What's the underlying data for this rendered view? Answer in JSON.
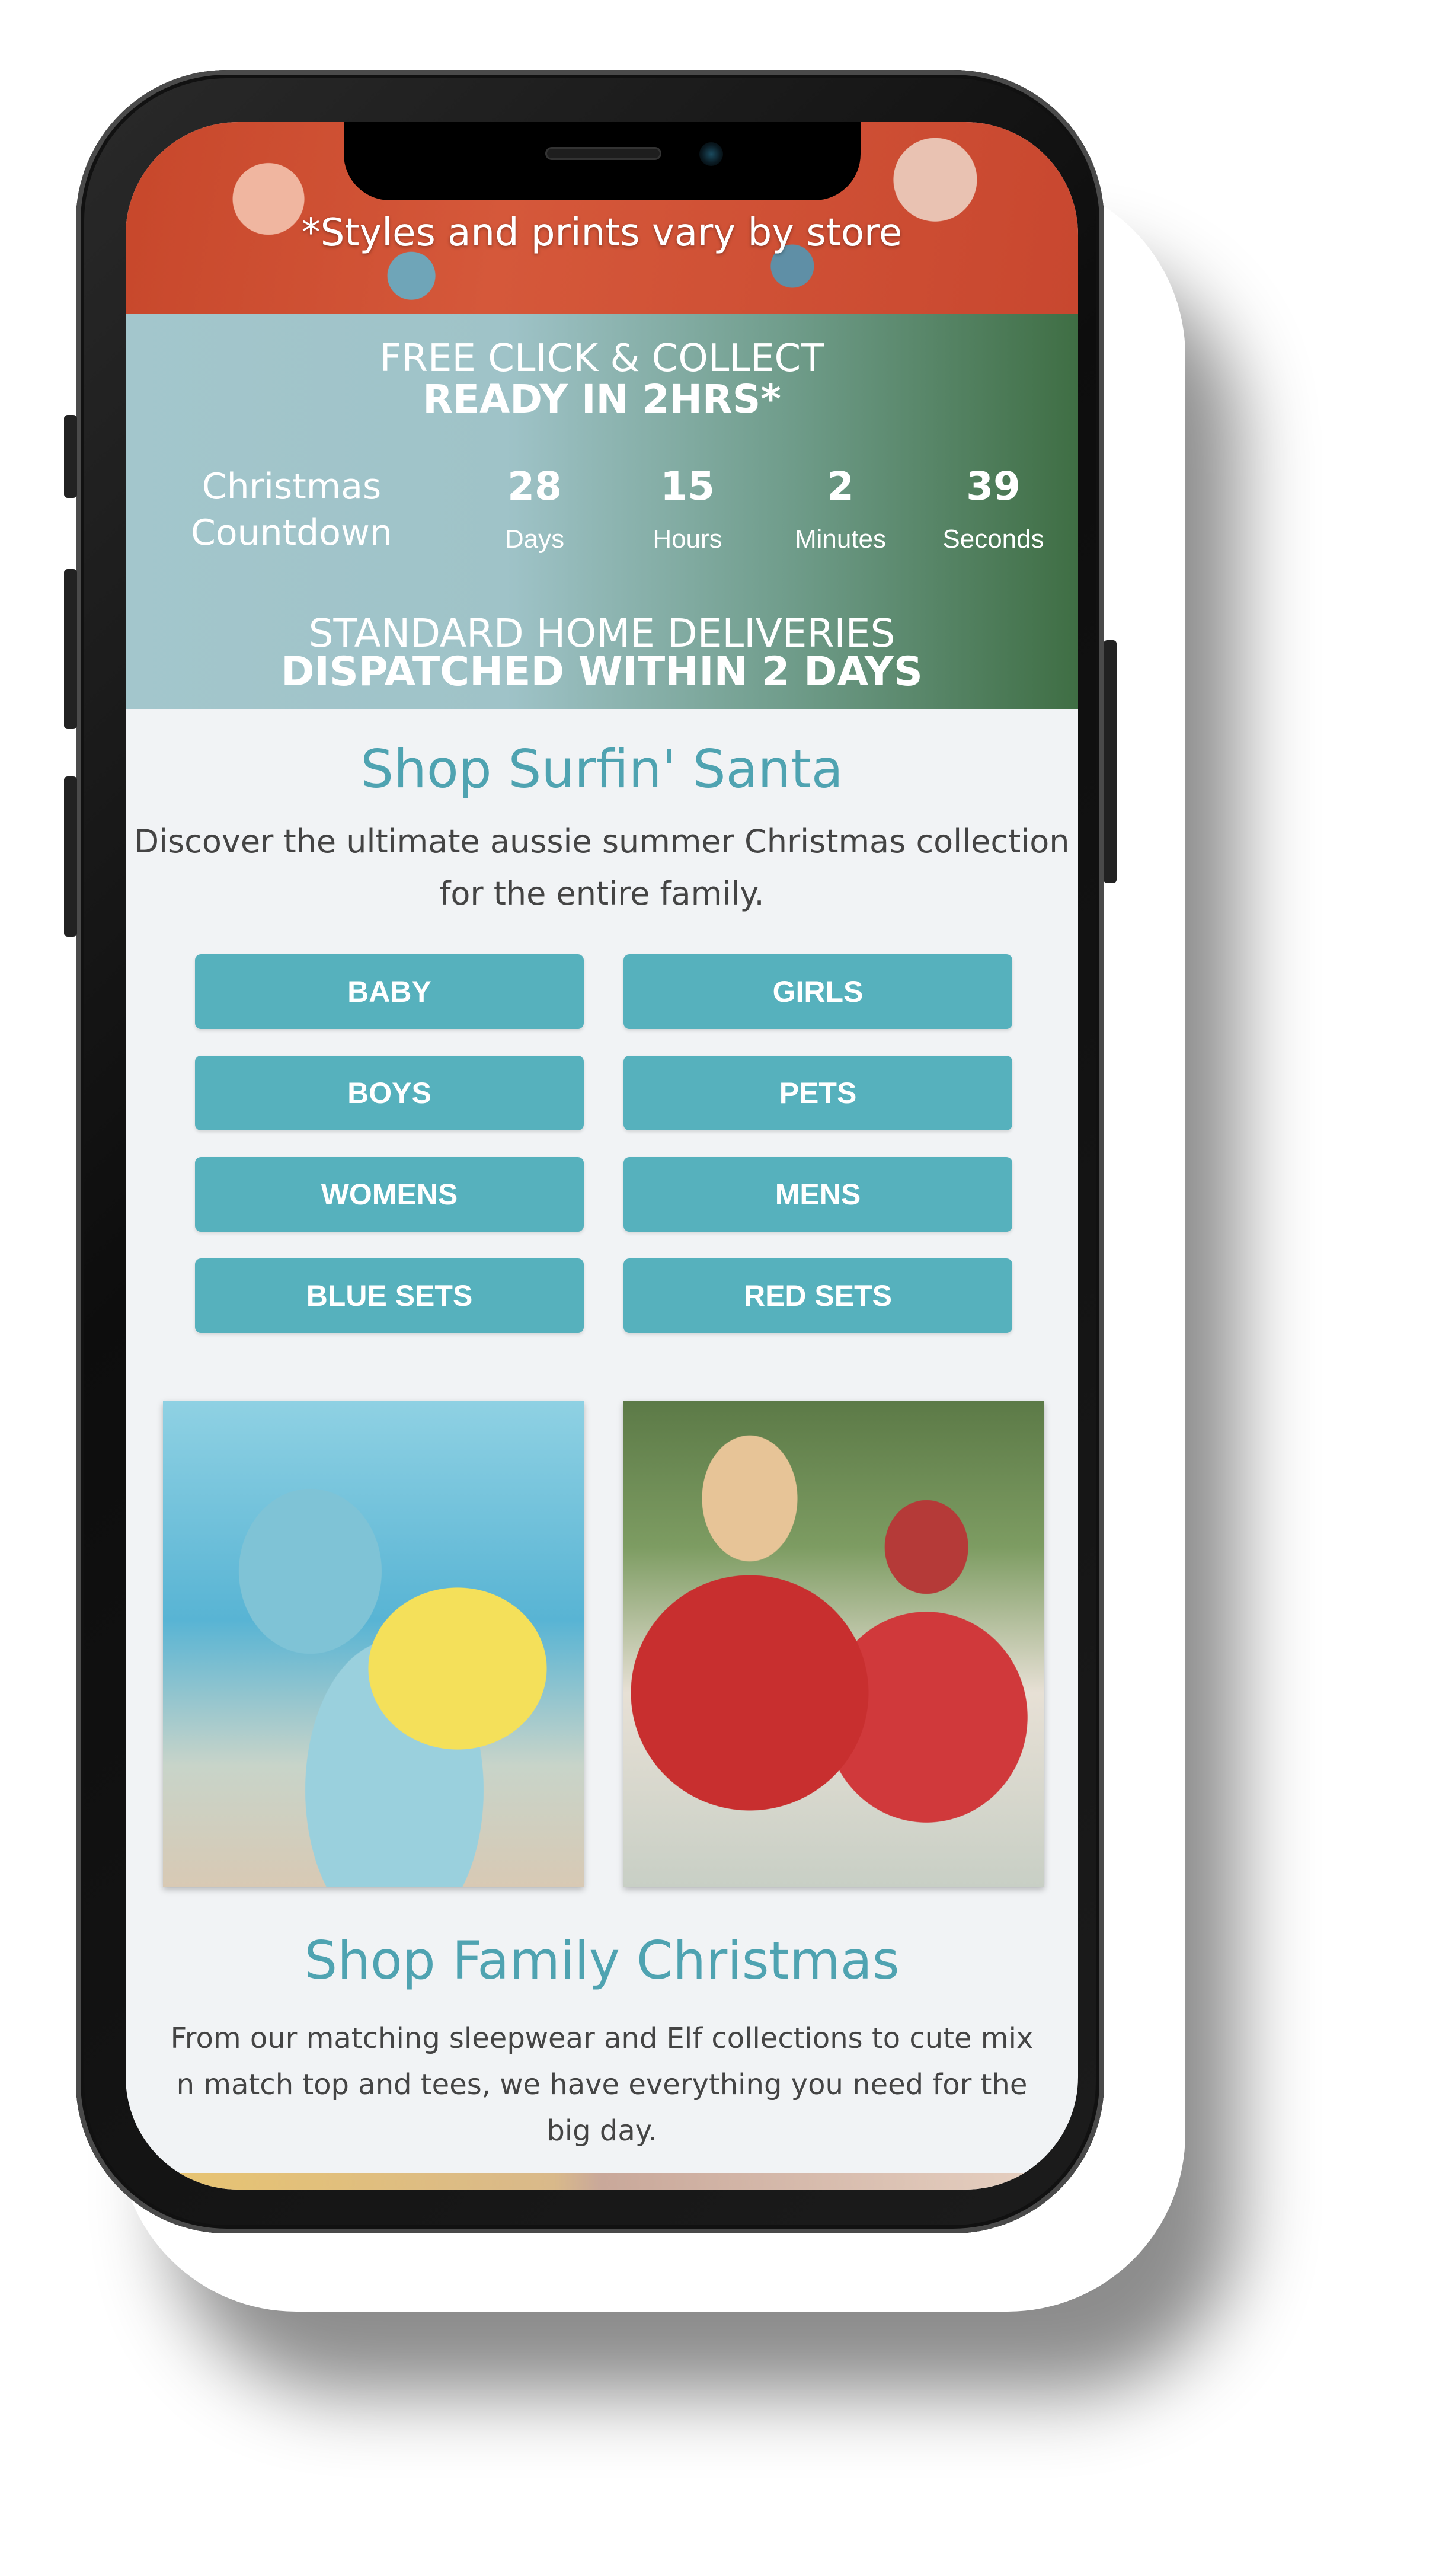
{
  "top_banner": {
    "text": "*Styles and prints vary by store"
  },
  "promo": {
    "click_collect_line1": "FREE CLICK & COLLECT",
    "click_collect_line2": "READY IN 2HRS*",
    "countdown": {
      "label": "Christmas Countdown",
      "units": [
        {
          "value": "28",
          "name": "Days"
        },
        {
          "value": "15",
          "name": "Hours"
        },
        {
          "value": "2",
          "name": "Minutes"
        },
        {
          "value": "39",
          "name": "Seconds"
        }
      ]
    },
    "delivery_line1": "STANDARD HOME DELIVERIES",
    "delivery_line2": "DISPATCHED WITHIN 2 DAYS"
  },
  "surfin_santa": {
    "title": "Shop Surfin' Santa",
    "description": "Discover the ultimate aussie summer Christmas collection for the entire family.",
    "buttons": [
      "BABY",
      "GIRLS",
      "BOYS",
      "PETS",
      "WOMENS",
      "MENS",
      "BLUE SETS",
      "RED SETS"
    ]
  },
  "family_christmas": {
    "title": "Shop Family Christmas",
    "description": "From our matching sleepwear and Elf collections to cute mix n match top and tees, we have everything you need for the big day."
  },
  "colors": {
    "accent_teal": "#56b1bd",
    "heading_teal": "#4fa3b1",
    "promo_green": "#3f6e44"
  }
}
